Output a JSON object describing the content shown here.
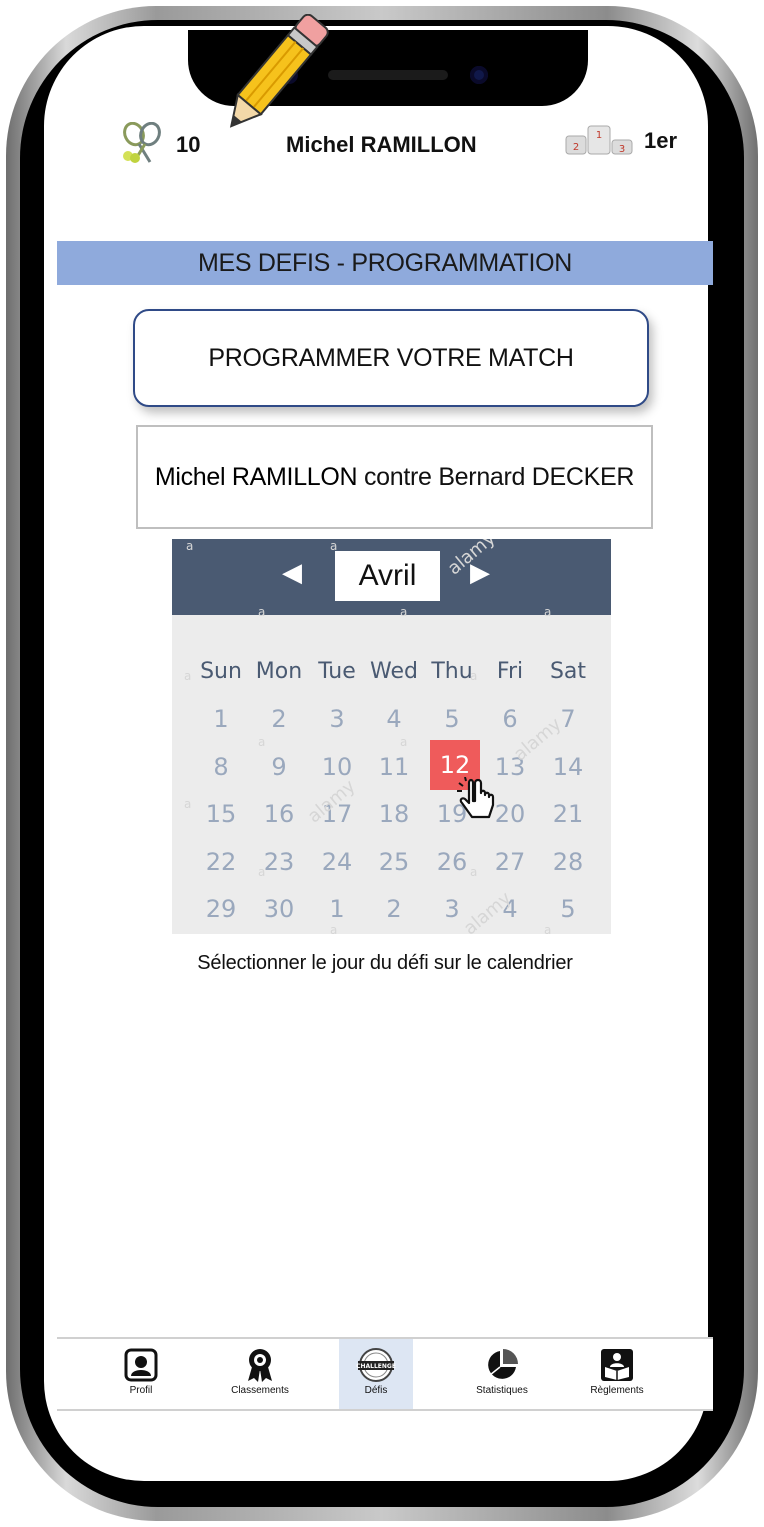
{
  "header": {
    "score": "10",
    "player_name": "Michel RAMILLON",
    "rank": "1er",
    "podium_places": [
      "2",
      "1",
      "3"
    ]
  },
  "section_title": "MES DEFIS - PROGRAMMATION",
  "schedule_button_label": "PROGRAMMER VOTRE MATCH",
  "matchup": {
    "player1": "Michel RAMILLON",
    "versus": "contre",
    "player2": "Bernard DECKER"
  },
  "calendar": {
    "month": "Avril",
    "prev_icon": "triangle-left",
    "next_icon": "triangle-right",
    "weekdays": [
      "Sun",
      "Mon",
      "Tue",
      "Wed",
      "Thu",
      "Fri",
      "Sat"
    ],
    "weeks": [
      [
        "1",
        "2",
        "3",
        "4",
        "5",
        "6",
        "7"
      ],
      [
        "8",
        "9",
        "10",
        "11",
        "12",
        "13",
        "14"
      ],
      [
        "15",
        "16",
        "17",
        "18",
        "19",
        "20",
        "21"
      ],
      [
        "22",
        "23",
        "24",
        "25",
        "26",
        "27",
        "28"
      ],
      [
        "29",
        "30",
        "1",
        "2",
        "3",
        "4",
        "5"
      ]
    ],
    "selected_day": "12",
    "selected_color": "#ef5b5b",
    "watermark": "alamy"
  },
  "instruction": "Sélectionner le jour du défi sur le calendrier",
  "nav": [
    {
      "label": "Profil",
      "icon": "profile-icon"
    },
    {
      "label": "Classements",
      "icon": "ribbon-icon"
    },
    {
      "label": "Défis",
      "icon": "challenge-badge-icon",
      "active": true,
      "badge_text": "CHALLENGE"
    },
    {
      "label": "Statistiques",
      "icon": "pie-chart-icon"
    },
    {
      "label": "Règlements",
      "icon": "rulebook-icon"
    }
  ],
  "colors": {
    "section_bar": "#8faadc",
    "calendar_header": "#4a5a72",
    "button_border": "#2f4a87",
    "nav_active": "#dde6f3"
  }
}
